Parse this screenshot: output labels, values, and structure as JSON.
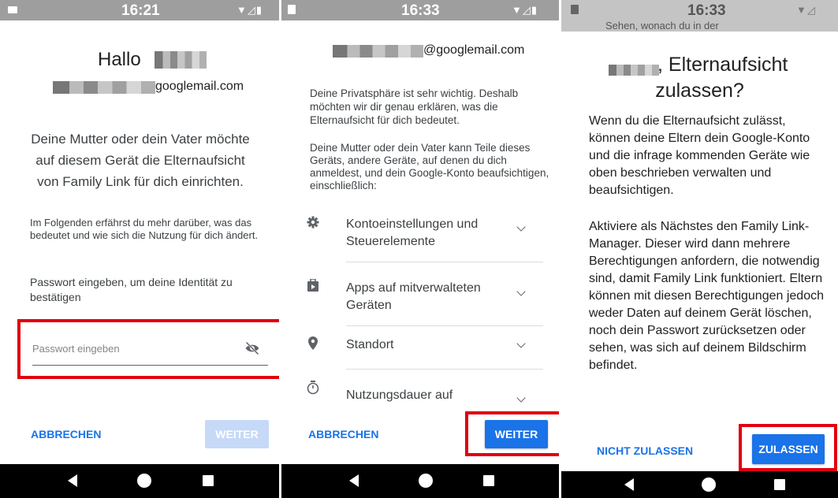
{
  "panel1": {
    "status_time": "16:21",
    "greeting": "Hallo",
    "email_suffix": "googlemail.com",
    "intro": "Deine Mutter oder dein Vater möchte auf diesem Gerät die Elternaufsicht von Family Link für dich einrichten.",
    "info": "Im Folgenden erfährst du mehr darüber, was das bedeutet und wie sich die Nutzung für dich ändert.",
    "password_prompt": "Passwort eingeben, um deine Identität zu bestätigen",
    "password_placeholder": "Passwort eingeben",
    "cancel_label": "ABBRECHEN",
    "next_label": "WEITER"
  },
  "panel2": {
    "status_time": "16:33",
    "email_suffix": "@googlemail.com",
    "para1": "Deine Privatsphäre ist sehr wichtig. Deshalb möchten wir dir genau erklären, was die Elternaufsicht für dich bedeutet.",
    "para2": "Deine Mutter oder dein Vater kann Teile dieses Geräts, andere Geräte, auf denen du dich anmeldest, und dein Google-Konto beaufsichtigen, einschließlich:",
    "items": [
      {
        "label": "Kontoeinstellungen und Steuerelemente",
        "icon": "gear-icon"
      },
      {
        "label": "Apps auf mitverwalteten Geräten",
        "icon": "briefcase-icon"
      },
      {
        "label": "Standort",
        "icon": "location-pin-icon"
      },
      {
        "label": "Nutzungsdauer auf",
        "icon": "timer-icon"
      }
    ],
    "cancel_label": "ABBRECHEN",
    "next_label": "WEITER"
  },
  "panel3": {
    "status_time": "16:33",
    "scroll_hint": "Sehen, wonach du in der",
    "title_line1": ", Elternaufsicht",
    "title_line2": "zulassen?",
    "para1": "Wenn du die Elternaufsicht zulässt, können deine Eltern dein Google-Konto und die infrage kommenden Geräte wie oben beschrieben verwalten und beaufsichtigen.",
    "para2": "Aktiviere als Nächstes den Family Link-Manager. Dieser wird dann mehrere Berechtigungen anfordern, die notwendig sind, damit Family Link funktioniert. Eltern können mit diesen Berechtigungen jedoch weder Daten auf deinem Gerät löschen, noch dein Passwort zurücksetzen oder sehen, was sich auf deinem Bildschirm befindet.",
    "deny_label": "NICHT ZULASSEN",
    "allow_label": "ZULASSEN"
  },
  "colors": {
    "accent": "#1a73e8",
    "highlight": "#e0000f",
    "statusbar": "#9e9e9e"
  }
}
